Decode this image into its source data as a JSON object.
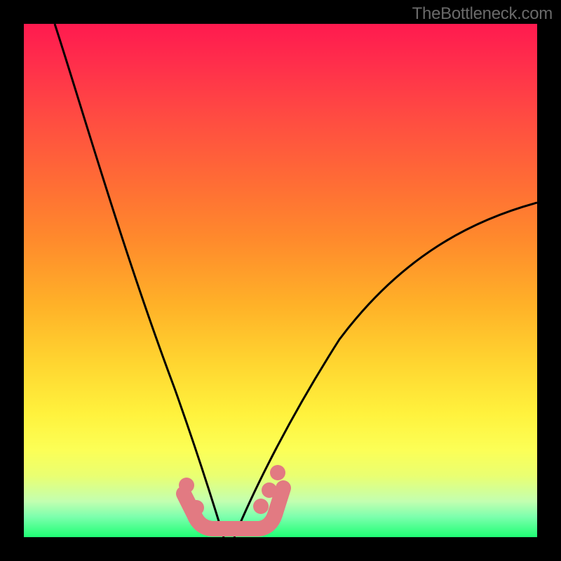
{
  "watermark": "TheBottleneck.com",
  "chart_data": {
    "type": "line",
    "title": "",
    "xlabel": "",
    "ylabel": "",
    "grid": false,
    "xlim": [
      0,
      100
    ],
    "ylim": [
      0,
      100
    ],
    "series": [
      {
        "name": "left-curve",
        "x": [
          6,
          10,
          15,
          20,
          25,
          28,
          31,
          33,
          35,
          37,
          40
        ],
        "y": [
          100,
          82,
          62,
          44,
          29,
          21,
          14,
          9,
          6,
          3,
          0
        ]
      },
      {
        "name": "right-curve",
        "x": [
          40,
          43,
          47,
          52,
          58,
          65,
          73,
          82,
          92,
          100
        ],
        "y": [
          0,
          4,
          9,
          15,
          23,
          31,
          40,
          49,
          58,
          65
        ]
      },
      {
        "name": "bottom-band",
        "x": [
          31,
          48
        ],
        "y": [
          0,
          0
        ]
      }
    ],
    "markers": {
      "name": "dots",
      "color": "#e27a82",
      "points": [
        {
          "x": 31,
          "y": 9
        },
        {
          "x": 33,
          "y": 4
        },
        {
          "x": 45,
          "y": 6
        },
        {
          "x": 47,
          "y": 9
        },
        {
          "x": 49,
          "y": 13
        }
      ]
    },
    "gradient_stops": [
      {
        "pos": 0,
        "color": "#ff1a4f"
      },
      {
        "pos": 50,
        "color": "#ff8a2c"
      },
      {
        "pos": 80,
        "color": "#fff23d"
      },
      {
        "pos": 100,
        "color": "#1fff74"
      }
    ]
  }
}
